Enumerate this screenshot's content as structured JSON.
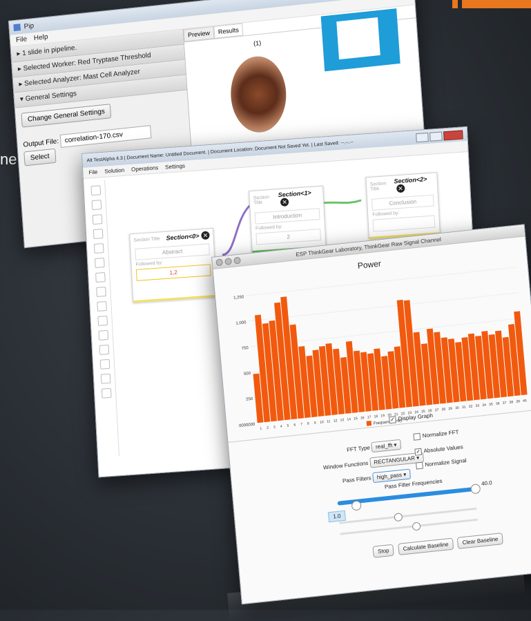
{
  "background": {
    "stray_text": "ne"
  },
  "pip": {
    "title": "Pip",
    "menu": [
      "File",
      "Help"
    ],
    "accordion": [
      "▸ 1 slide in pipeline.",
      "▸ Selected Worker: Red Tryptase Threshold",
      "▸ Selected Analyzer: Mast Cell Analyzer",
      "▾ General Settings"
    ],
    "change_settings": "Change General Settings",
    "output_label": "Output File:",
    "output_value": "correlation-170.csv",
    "select": "Select",
    "tabs": [
      "Preview",
      "Results"
    ],
    "image_index": "(1)"
  },
  "testalpha": {
    "title": "Alt TestAlpha 4.3  |  Document Name: Untitled Document.  |  Document Location: Document Not Saved Yet.  |  Last Saved: --.--.--",
    "menu": [
      "File",
      "Solution",
      "Operations",
      "Settings"
    ],
    "cards": [
      {
        "header": "Section<0>",
        "title_label": "Section Title",
        "title_value": "Abstract",
        "follow_label": "Followed by:",
        "follow_value": "1,2"
      },
      {
        "header": "Section<1>",
        "title_label": "Section Title",
        "title_value": "Introduction",
        "follow_label": "Followed by:",
        "follow_value": "2"
      },
      {
        "header": "Section<2>",
        "title_label": "Section Title",
        "title_value": "Conclusion",
        "follow_label": "Followed by:",
        "follow_value": ""
      }
    ]
  },
  "thinkgear": {
    "title": "ESP ThinkGear Laboratory, ThinkGear Raw Signal Channel",
    "display_graph": "Display Graph",
    "fft_type_label": "FFT Type",
    "fft_type_value": "real_fft",
    "normalize_fft": "Normalize FFT",
    "window_label": "Window Functions",
    "window_value": "RECTANGULAR",
    "absolute_values": "Absolute Values",
    "normalize_signal": "Normalize Signal",
    "pass_label": "Pass Filters",
    "pass_value": "high_pass",
    "pass_freq_label": "Pass Filter Frequencies",
    "slider_low": "1.0",
    "slider_high": "40.0",
    "buttons": [
      "Stop",
      "Calculate Baseline",
      "Clear Baseline"
    ]
  },
  "chart_data": {
    "type": "bar",
    "title": "Power",
    "xlabel": "",
    "ylabel": "",
    "legend": "Frequency (Hz)",
    "ylim": [
      0,
      1250
    ],
    "yticks": [
      "0000000",
      "250",
      "500",
      "750",
      "1,000",
      "1,250"
    ],
    "categories": [
      "1",
      "2",
      "3",
      "4",
      "5",
      "6",
      "7",
      "8",
      "9",
      "10",
      "11",
      "12",
      "13",
      "14",
      "15",
      "16",
      "17",
      "18",
      "19",
      "20",
      "21",
      "22",
      "23",
      "24",
      "25",
      "26",
      "27",
      "28",
      "29",
      "30",
      "31",
      "32",
      "33",
      "34",
      "35",
      "36",
      "37",
      "38",
      "39",
      "40"
    ],
    "values": [
      480,
      1050,
      960,
      980,
      1150,
      1200,
      920,
      700,
      600,
      650,
      680,
      700,
      640,
      550,
      700,
      600,
      580,
      560,
      600,
      520,
      560,
      600,
      1050,
      1040,
      720,
      600,
      740,
      700,
      640,
      620,
      580,
      620,
      650,
      620,
      660,
      620,
      650,
      580,
      700,
      820
    ],
    "color": "#f15a0e"
  }
}
